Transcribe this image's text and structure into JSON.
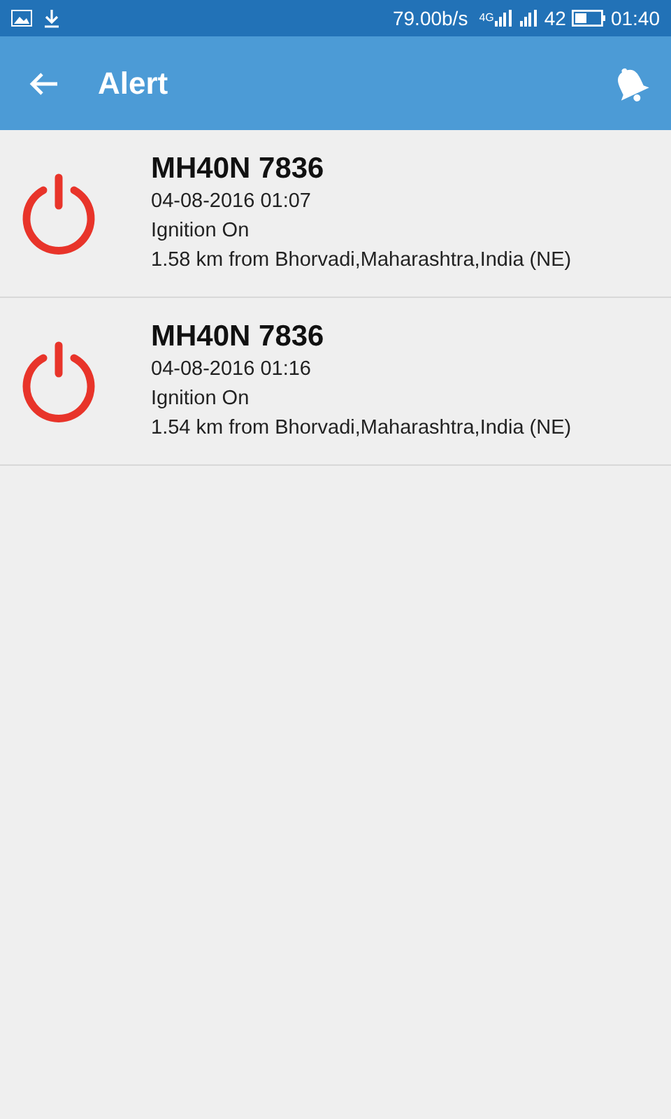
{
  "status_bar": {
    "speed": "79.00b/s",
    "network": "4G",
    "battery": "42",
    "time": "01:40"
  },
  "app_bar": {
    "title": "Alert"
  },
  "alerts": [
    {
      "kind": "ignition",
      "vehicle": "MH40N 7836",
      "datetime": "04-08-2016 01:07",
      "event": "Ignition On",
      "location": "1.58 km from Bhorvadi,Maharashtra,India (NE)"
    },
    {
      "kind": "ignition",
      "vehicle": "MH40N 7836",
      "datetime": "04-08-2016 01:16",
      "event": "Ignition On",
      "location": "1.54 km from Bhorvadi,Maharashtra,India (NE)"
    }
  ]
}
